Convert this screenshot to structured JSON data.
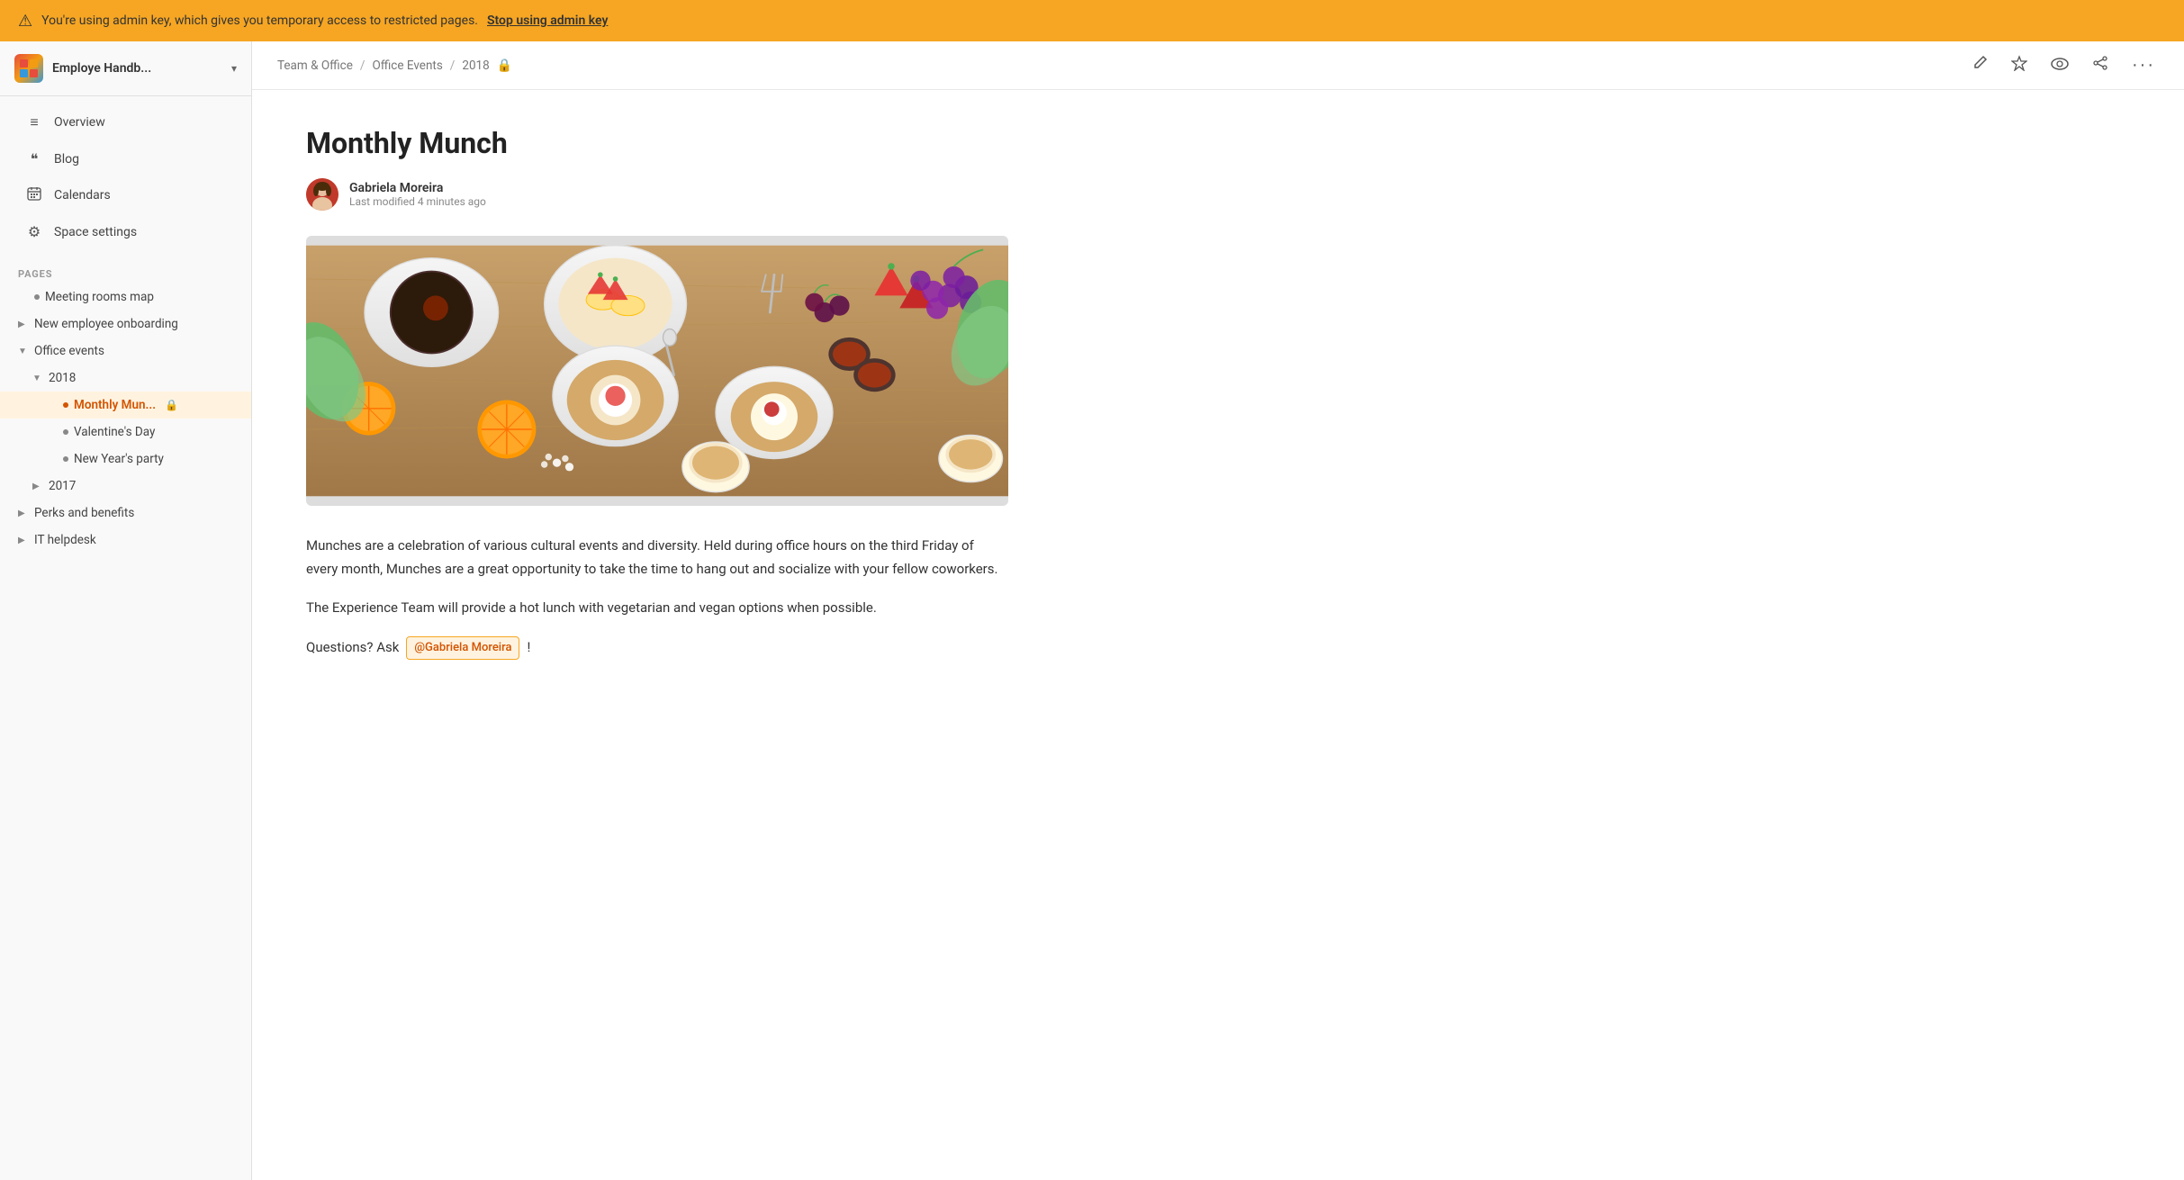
{
  "banner": {
    "warning_icon": "⚠",
    "text": "You're using admin key, which gives you temporary access to restricted pages.",
    "link_label": "Stop using admin key"
  },
  "sidebar": {
    "app_title": "Employe Handb...",
    "chevron": "▾",
    "nav_items": [
      {
        "id": "overview",
        "icon": "≡",
        "label": "Overview"
      },
      {
        "id": "blog",
        "icon": "❝",
        "label": "Blog"
      },
      {
        "id": "calendars",
        "icon": "▦",
        "label": "Calendars"
      },
      {
        "id": "space-settings",
        "icon": "⚙",
        "label": "Space settings"
      }
    ],
    "pages_label": "PAGES",
    "tree": [
      {
        "id": "meeting-rooms-map",
        "level": 0,
        "type": "bullet",
        "label": "Meeting rooms map"
      },
      {
        "id": "new-employee-onboarding",
        "level": 0,
        "type": "arrow-right",
        "label": "New employee onboarding"
      },
      {
        "id": "office-events",
        "level": 0,
        "type": "arrow-down",
        "label": "Office events"
      },
      {
        "id": "2018",
        "level": 1,
        "type": "arrow-down",
        "label": "2018"
      },
      {
        "id": "monthly-munch",
        "level": 2,
        "type": "bullet",
        "label": "Monthly Mun...",
        "active": true,
        "locked": true
      },
      {
        "id": "valentines-day",
        "level": 2,
        "type": "bullet",
        "label": "Valentine's Day"
      },
      {
        "id": "new-years-party",
        "level": 2,
        "type": "bullet",
        "label": "New Year's party"
      },
      {
        "id": "2017",
        "level": 1,
        "type": "arrow-right",
        "label": "2017"
      },
      {
        "id": "perks-and-benefits",
        "level": 0,
        "type": "arrow-right",
        "label": "Perks and benefits"
      },
      {
        "id": "it-helpdesk",
        "level": 0,
        "type": "arrow-right",
        "label": "IT helpdesk"
      }
    ]
  },
  "breadcrumb": {
    "items": [
      "Team & Office",
      "Office Events",
      "2018"
    ],
    "lock_icon": "🔒"
  },
  "topbar_actions": {
    "edit_icon": "✏",
    "star_icon": "☆",
    "view_icon": "👁",
    "share_icon": "↗",
    "more_icon": "⋯"
  },
  "page": {
    "title": "Monthly Munch",
    "author_name": "Gabriela Moreira",
    "author_meta": "Last modified 4 minutes ago",
    "body_p1": "Munches are a celebration of various cultural events and diversity. Held during office hours on the third Friday of every month, Munches are a great opportunity to take the time to hang out and socialize with your fellow coworkers.",
    "body_p2": "The Experience Team will provide a hot lunch with vegetarian and vegan options when possible.",
    "questions_label": "Questions? Ask",
    "mention_label": "@Gabriela Moreira",
    "exclamation": "!"
  }
}
